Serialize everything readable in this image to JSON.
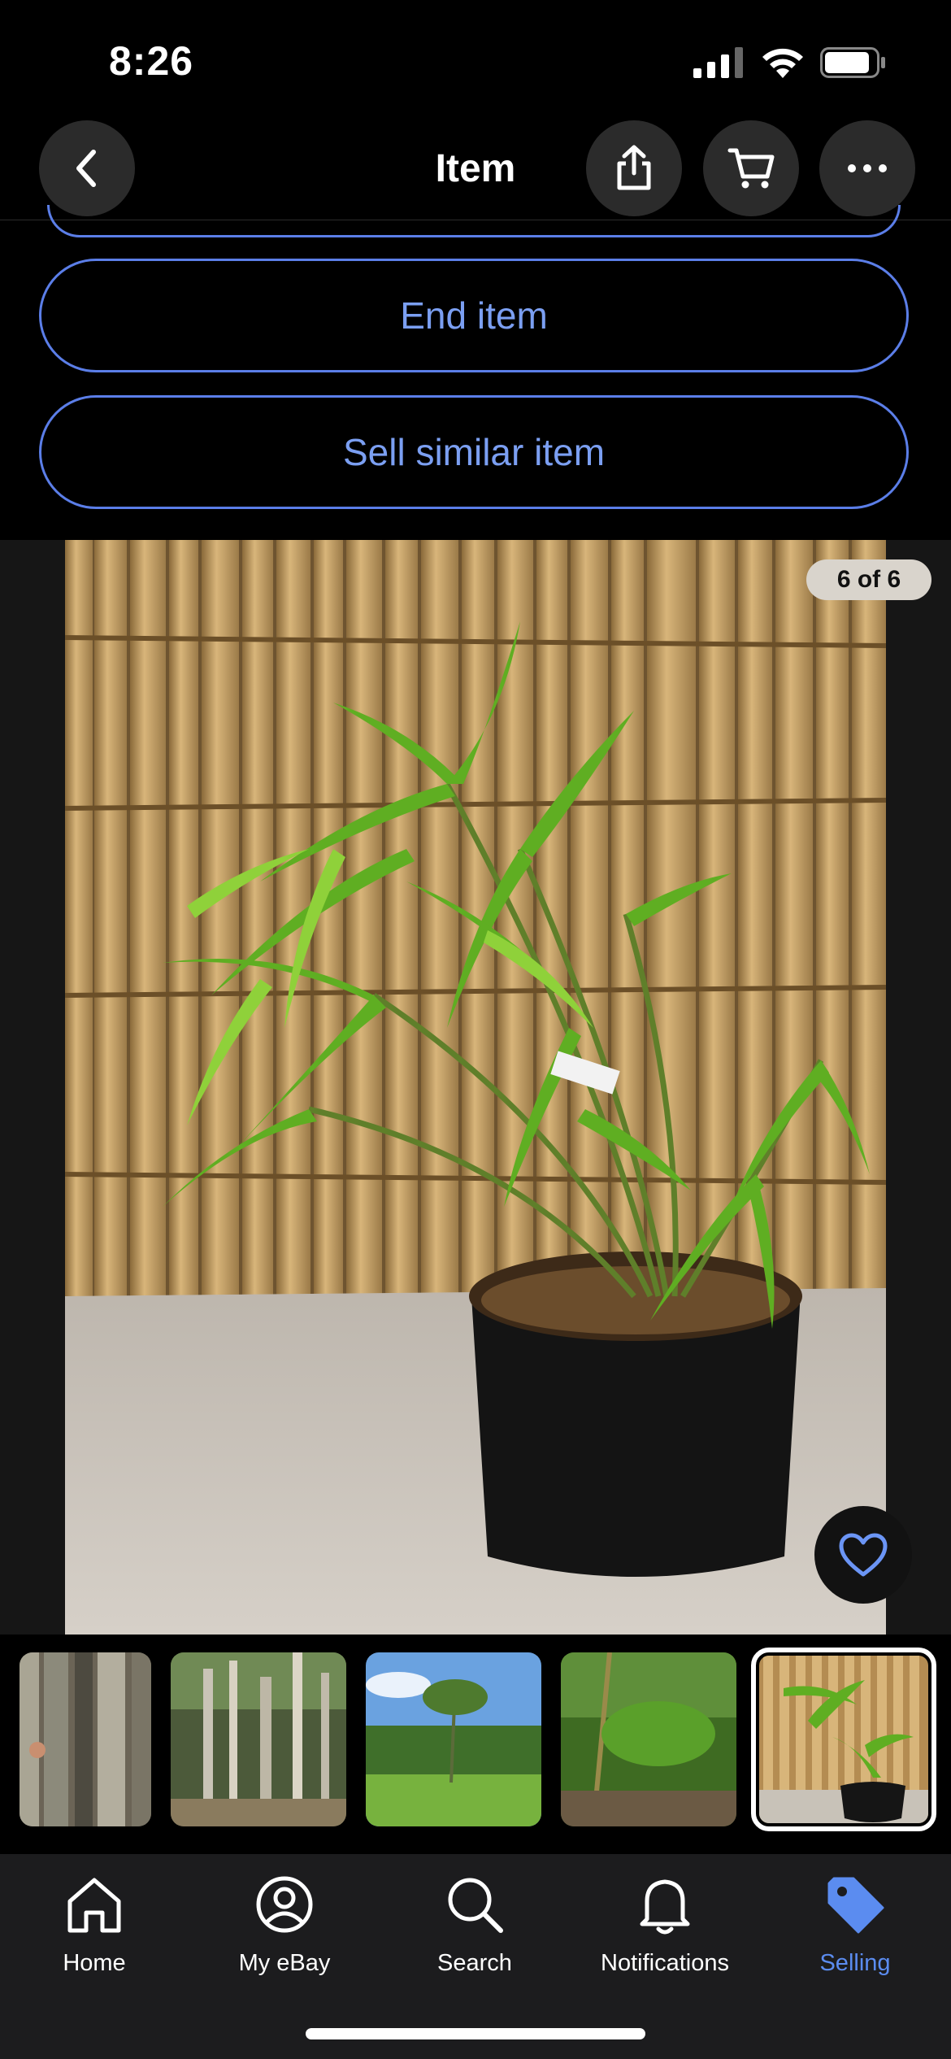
{
  "status_bar": {
    "time": "8:26"
  },
  "header": {
    "title": "Item"
  },
  "actions": {
    "end_item": "End item",
    "sell_similar": "Sell similar item"
  },
  "gallery": {
    "counter": "6 of 6",
    "selected_index": 5,
    "thumbnails": [
      "bamboo-culms-closeup",
      "bamboo-grove",
      "bamboo-field-sky",
      "bamboo-garden",
      "potted-bamboo"
    ]
  },
  "tabs": [
    {
      "label": "Home",
      "icon": "home-icon"
    },
    {
      "label": "My eBay",
      "icon": "user-circle-icon"
    },
    {
      "label": "Search",
      "icon": "search-icon"
    },
    {
      "label": "Notifications",
      "icon": "bell-icon"
    },
    {
      "label": "Selling",
      "icon": "tag-icon",
      "active": true
    }
  ],
  "colors": {
    "accent": "#5b8cf0",
    "pill_border": "#5b7ee8",
    "background": "#000000"
  }
}
